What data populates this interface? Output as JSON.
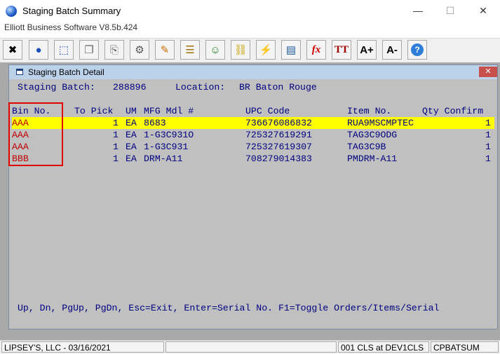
{
  "window": {
    "title": "Staging Batch Summary",
    "subtitle": "Elliott Business Software V8.5b.424"
  },
  "window_controls": {
    "minimize": "—",
    "maximize": "☐",
    "close": "✕"
  },
  "toolbar": {
    "buttons": [
      {
        "name": "close-x-icon",
        "glyph": "✖"
      },
      {
        "name": "globe-icon",
        "glyph": "●"
      },
      {
        "name": "select-icon",
        "glyph": "⬚"
      },
      {
        "name": "copy-icon",
        "glyph": "❐"
      },
      {
        "name": "paste-icon",
        "glyph": "⎘"
      },
      {
        "name": "gear-icon",
        "glyph": "⚙"
      },
      {
        "name": "pencil-icon",
        "glyph": "✎"
      },
      {
        "name": "notepad-icon",
        "glyph": "☰"
      },
      {
        "name": "users-icon",
        "glyph": "☺"
      },
      {
        "name": "link-icon",
        "glyph": "⛓"
      },
      {
        "name": "lightning-icon",
        "glyph": "⚡"
      },
      {
        "name": "window-icon",
        "glyph": "▤"
      },
      {
        "name": "function-icon",
        "glyph": "fx"
      },
      {
        "name": "text-size-icon",
        "glyph": "TT"
      },
      {
        "name": "font-increase-icon",
        "glyph": "A+"
      },
      {
        "name": "font-decrease-icon",
        "glyph": "A-"
      },
      {
        "name": "help-icon",
        "glyph": "?"
      }
    ]
  },
  "detail": {
    "title": "Staging Batch Detail",
    "close": "✕",
    "staging_batch_label": "Staging Batch:",
    "staging_batch_value": "288896",
    "location_label": "Location:",
    "location_value": "BR Baton Rouge",
    "columns": {
      "bin": "Bin No.",
      "to_pick": "To Pick",
      "um": "UM",
      "mfg": "MFG Mdl #",
      "upc": "UPC Code",
      "item": "Item No.",
      "qty": "Qty Confirm"
    },
    "rows": [
      {
        "bin": "AAA",
        "to_pick": "1",
        "um": "EA",
        "mfg": "8683",
        "upc": "736676086832",
        "item": "RUA9MSCMPTEC",
        "qty": "1",
        "selected": true
      },
      {
        "bin": "AAA",
        "to_pick": "1",
        "um": "EA",
        "mfg": "1-G3C931O",
        "upc": "725327619291",
        "item": "TAG3C9ODG",
        "qty": "1",
        "selected": false
      },
      {
        "bin": "AAA",
        "to_pick": "1",
        "um": "EA",
        "mfg": "1-G3C931",
        "upc": "725327619307",
        "item": "TAG3C9B",
        "qty": "1",
        "selected": false
      },
      {
        "bin": "BBB",
        "to_pick": "1",
        "um": "EA",
        "mfg": "DRM-A11",
        "upc": "708279014383",
        "item": "PMDRM-A11",
        "qty": "1",
        "selected": false
      }
    ],
    "footer": "Up, Dn, PgUp, PgDn, Esc=Exit, Enter=Serial No. F1=Toggle Orders/Items/Serial"
  },
  "status": {
    "company": "LIPSEY'S, LLC - 03/16/2021",
    "blank": "",
    "session": "001 CLS at DEV1CLS",
    "program": "CPBATSUM"
  },
  "colors": {
    "highlight": "#ffff00",
    "terminal_text": "#000080",
    "bin_text": "#c00000",
    "annotation_box": "#e00000"
  }
}
